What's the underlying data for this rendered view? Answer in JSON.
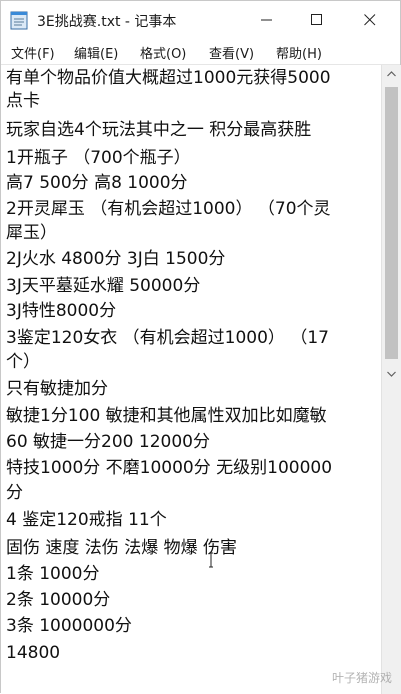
{
  "window": {
    "title": "3E挑战赛.txt - 记事本",
    "app_icon": "notepad-icon",
    "controls": {
      "minimize_icon": "minimize-icon",
      "maximize_icon": "maximize-icon",
      "close_icon": "close-icon"
    }
  },
  "menu": {
    "file": "文件(F)",
    "edit": "编辑(E)",
    "format": "格式(O)",
    "view": "查看(V)",
    "help": "帮助(H)"
  },
  "document": {
    "lines": [
      "有单个物品价值大概超过1000元获得5000",
      "点卡",
      "玩家自选4个玩法其中之一 积分最高获胜",
      "1开瓶子  （700个瓶子）",
      "高7 500分 高8 1000分",
      "2开灵犀玉  （有机会超过1000）  （70个灵",
      "犀玉）",
      "2J火水 4800分 3J白 1500分",
      "3J天平墓延水耀 50000分",
      "3J特性8000分",
      "3鉴定120女衣  （有机会超过1000）   （17",
      "个）",
      "只有敏捷加分",
      "敏捷1分100 敏捷和其他属性双加比如魔敏",
      "60 敏捷一分200 12000分",
      "特技1000分 不磨10000分 无级别100000",
      "分",
      "4 鉴定120戒指 11个",
      "固伤 速度 法伤 法爆 物爆 伤害",
      "1条 1000分",
      "2条 10000分",
      "3条 1000000分",
      "14800"
    ]
  },
  "scrollbar": {
    "up_icon": "scroll-up-arrow-icon",
    "down_icon": "scroll-down-arrow-icon"
  },
  "watermark": "叶子猪游戏",
  "colors": {
    "text": "#111111",
    "scrollbar_thumb": "#c2c2c2",
    "scrollbar_track": "#f0f0f0"
  }
}
